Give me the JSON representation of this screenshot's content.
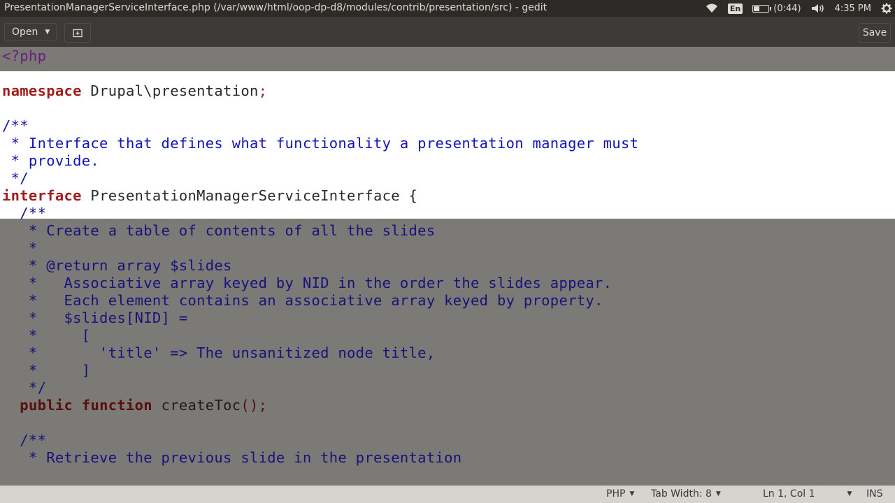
{
  "window": {
    "title": "PresentationManagerServiceInterface.php (/var/www/html/oop-dp-d8/modules/contrib/presentation/src) - gedit"
  },
  "tray": {
    "keyboard": "En",
    "battery_time": "(0:44)",
    "battery_level": 0.45,
    "clock": "4:35 PM",
    "icons": [
      "wifi-icon",
      "keyboard-layout-icon",
      "battery-icon",
      "volume-icon",
      "gear-icon"
    ]
  },
  "toolbar": {
    "open_label": "Open",
    "save_label": "Save",
    "new_tab_icon": "new-tab-icon"
  },
  "editor": {
    "lines": [
      [
        [
          "pp",
          "<?php"
        ]
      ],
      [],
      [
        [
          "kw",
          "namespace"
        ],
        [
          "tx",
          " Drupal\\presentation"
        ],
        [
          "pn",
          ";"
        ]
      ],
      [],
      [
        [
          "cm",
          "/**"
        ]
      ],
      [
        [
          "cm",
          " * Interface that defines what functionality a presentation manager must"
        ]
      ],
      [
        [
          "cm",
          " * provide."
        ]
      ],
      [
        [
          "cm",
          " */"
        ]
      ],
      [
        [
          "kw",
          "interface"
        ],
        [
          "tx",
          " PresentationManagerServiceInterface {"
        ]
      ],
      [
        [
          "cm",
          "  /**"
        ]
      ],
      [
        [
          "cm",
          "   * Create a table of contents of all the slides"
        ]
      ],
      [
        [
          "cm",
          "   *"
        ]
      ],
      [
        [
          "cm",
          "   * @return array $slides"
        ]
      ],
      [
        [
          "cm",
          "   *   Associative array keyed by NID in the order the slides appear."
        ]
      ],
      [
        [
          "cm",
          "   *   Each element contains an associative array keyed by property."
        ]
      ],
      [
        [
          "cm",
          "   *   $slides[NID] ="
        ]
      ],
      [
        [
          "cm",
          "   *     ["
        ]
      ],
      [
        [
          "cm",
          "   *       'title' => The unsanitized node title,"
        ]
      ],
      [
        [
          "cm",
          "   *     ]"
        ]
      ],
      [
        [
          "cm",
          "   */"
        ]
      ],
      [
        [
          "tx",
          "  "
        ],
        [
          "kw",
          "public"
        ],
        [
          "tx",
          " "
        ],
        [
          "kw",
          "function"
        ],
        [
          "tx",
          " createToc"
        ],
        [
          "pn",
          "();"
        ]
      ],
      [],
      [
        [
          "cm",
          "  /**"
        ]
      ],
      [
        [
          "cm",
          "   * Retrieve the previous slide in the presentation"
        ]
      ]
    ]
  },
  "statusbar": {
    "language": "PHP",
    "tab_width": "Tab Width: 8",
    "position": "Ln 1, Col 1",
    "mode": "INS"
  }
}
